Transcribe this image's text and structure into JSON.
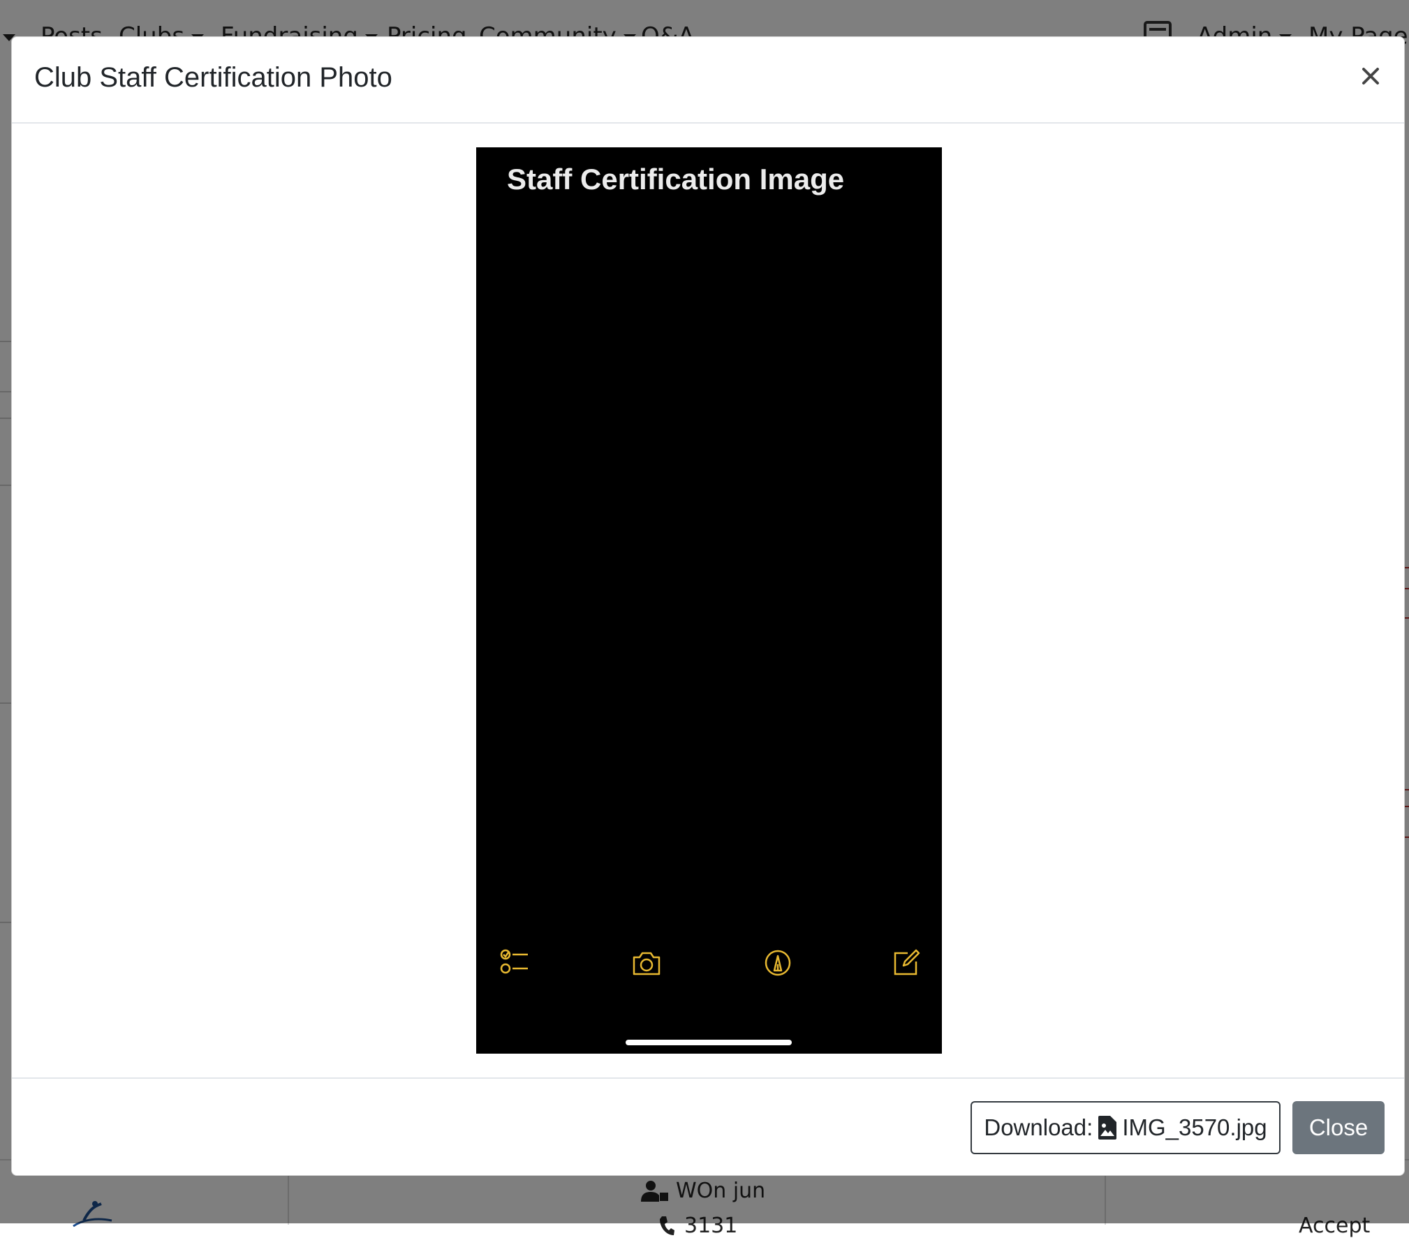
{
  "background": {
    "nav": {
      "items": [
        {
          "label": "Posts",
          "has_caret": false
        },
        {
          "label": "Clubs",
          "has_caret": true
        },
        {
          "label": "Fundraising",
          "has_caret": true
        },
        {
          "label": "Pricing",
          "has_caret": false
        },
        {
          "label": "Community",
          "has_caret": true
        },
        {
          "label": "Q&A",
          "has_caret": false
        }
      ],
      "admin_label": "Admin",
      "mypage_label": "My Page"
    },
    "table_row": {
      "user_name": "WOn jun",
      "phone": "3131",
      "status": "Accept"
    }
  },
  "modal": {
    "title": "Club Staff Certification Photo",
    "image": {
      "title_text": "Staff Certification Image",
      "toolbar_icons": [
        "checklist-icon",
        "camera-icon",
        "markup-icon",
        "compose-icon"
      ],
      "accent_color": "#e8b931"
    },
    "footer": {
      "download_prefix": "Download:",
      "file_name": "IMG_3570.jpg",
      "close_label": "Close"
    }
  }
}
